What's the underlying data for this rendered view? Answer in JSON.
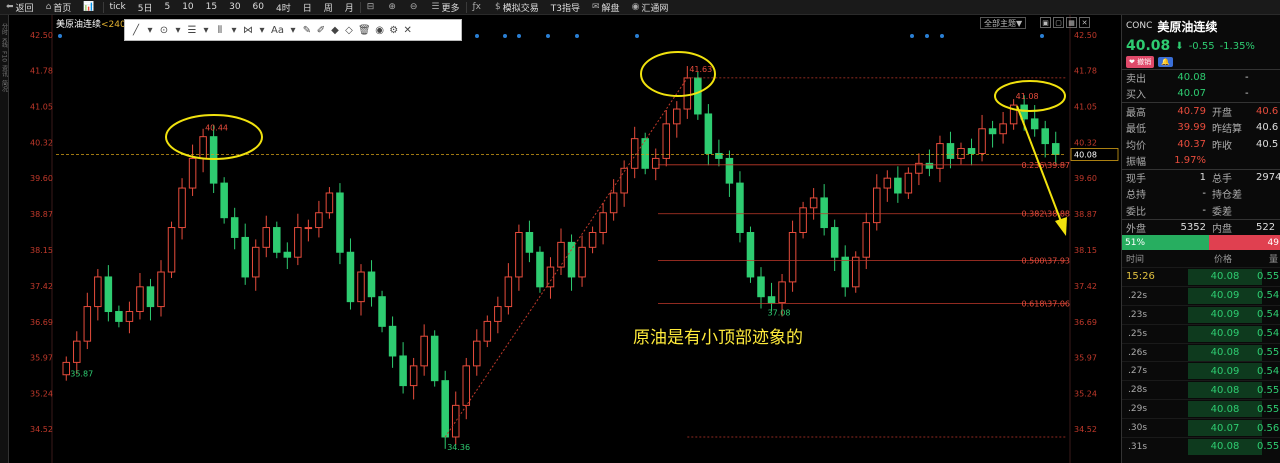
{
  "toolbar": {
    "items": [
      "返回",
      "首页",
      "",
      "tick",
      "5日",
      "5",
      "10",
      "15",
      "30",
      "60",
      "4时",
      "日",
      "周",
      "月",
      "",
      "",
      "",
      "更多",
      "",
      "模拟交易",
      "T3指导",
      "解盘",
      "汇通网"
    ]
  },
  "left_strip": [
    "分时",
    "K线",
    "F10",
    "资讯",
    "简况"
  ],
  "chart_title": {
    "name": "美原油连续",
    "period": "<240分"
  },
  "top_right_button": "全部主题▼",
  "drawbar": [
    "╱",
    "▾",
    "⊙",
    "▾",
    "☰",
    "▾",
    "⦀",
    "▾",
    "⋈",
    "▾",
    "Aa",
    "▾",
    "✎",
    "✐",
    "◆",
    "◇",
    "🗑",
    "◉",
    "⚙",
    "✕"
  ],
  "annotation": "原油是有小顶部迹象的",
  "axis_left_labels": [
    "42.50",
    "41.78",
    "41.05",
    "40.32",
    "39.60",
    "38.87",
    "38.15",
    "37.42",
    "36.69",
    "35.97",
    "35.24",
    "34.52"
  ],
  "axis_right_labels": [
    "42.50",
    "41.78",
    "41.05",
    "40.32",
    "39.60",
    "38.87",
    "38.15",
    "37.42",
    "36.69",
    "35.97",
    "35.24",
    "34.52"
  ],
  "price_markers": {
    "current": "40.08"
  },
  "peak_labels": [
    "40.44",
    "41.63",
    "41.08"
  ],
  "low_labels": [
    "35.87",
    "34.36",
    "37.08"
  ],
  "fib_labels": [
    "0.236\\39.87",
    "0.382\\38.88",
    "0.500\\37.93",
    "0.618\\37.06"
  ],
  "quote": {
    "code": "CONC",
    "name": "美原油连续",
    "price": "40.08",
    "arrow": "⬇",
    "change": "-0.55",
    "change_pct": "-1.35%",
    "tag1": "❤ 撤销",
    "tag2": "🔔",
    "sell_label": "卖出",
    "sell_price": "40.08",
    "sell_vol": "-",
    "buy_label": "买入",
    "buy_price": "40.07",
    "buy_vol": "-",
    "stats": [
      {
        "l1": "最高",
        "v1": "40.79",
        "c1": "up",
        "l2": "开盘",
        "v2": "40.6",
        "c2": "up"
      },
      {
        "l1": "最低",
        "v1": "39.99",
        "c1": "up",
        "l2": "昨结算",
        "v2": "40.6",
        "c2": "wh"
      },
      {
        "l1": "均价",
        "v1": "40.37",
        "c1": "up",
        "l2": "昨收",
        "v2": "40.5",
        "c2": "wh"
      },
      {
        "l1": "振幅",
        "v1": "1.97%",
        "c1": "up",
        "l2": "",
        "v2": "",
        "c2": "wh"
      },
      {
        "l1": "现手",
        "v1": "1",
        "c1": "wh",
        "l2": "总手",
        "v2": "2974",
        "c2": "wh"
      },
      {
        "l1": "总持",
        "v1": "-",
        "c1": "wh",
        "l2": "持仓差",
        "v2": "",
        "c2": "wh"
      },
      {
        "l1": "委比",
        "v1": "-",
        "c1": "wh",
        "l2": "委差",
        "v2": "",
        "c2": "wh"
      },
      {
        "l1": "外盘",
        "v1": "5352",
        "c1": "wh",
        "l2": "内盘",
        "v2": "522",
        "c2": "wh"
      }
    ],
    "ratio_left": "51%",
    "ratio_right": "49"
  },
  "ticks": {
    "headers": [
      "时间",
      "价格",
      "量"
    ],
    "rows": [
      {
        "t": "15:26",
        "p": "40.08",
        "v": "0.55"
      },
      {
        "t": ".22s",
        "p": "40.09",
        "v": "0.54"
      },
      {
        "t": ".23s",
        "p": "40.09",
        "v": "0.54"
      },
      {
        "t": ".25s",
        "p": "40.09",
        "v": "0.54"
      },
      {
        "t": ".26s",
        "p": "40.08",
        "v": "0.55"
      },
      {
        "t": ".27s",
        "p": "40.09",
        "v": "0.54"
      },
      {
        "t": ".28s",
        "p": "40.08",
        "v": "0.55"
      },
      {
        "t": ".29s",
        "p": "40.08",
        "v": "0.55"
      },
      {
        "t": ".30s",
        "p": "40.07",
        "v": "0.56"
      },
      {
        "t": ".31s",
        "p": "40.08",
        "v": "0.55"
      }
    ]
  },
  "chart_data": {
    "type": "candlestick",
    "symbol": "美原油连续",
    "period": "240分",
    "ylim": [
      34.4,
      42.6
    ],
    "up_color": "#e74c3c",
    "down_color": "#2ecc71",
    "closes": [
      35.87,
      36.3,
      37.0,
      37.6,
      36.9,
      36.7,
      36.9,
      37.4,
      37.0,
      37.7,
      38.6,
      39.4,
      40.0,
      40.44,
      39.5,
      38.8,
      38.4,
      37.6,
      38.2,
      38.6,
      38.1,
      38.0,
      38.6,
      38.6,
      38.9,
      39.3,
      38.1,
      37.1,
      37.7,
      37.2,
      36.6,
      36.0,
      35.4,
      35.8,
      36.4,
      35.5,
      34.36,
      35.0,
      35.8,
      36.3,
      36.7,
      37.0,
      37.6,
      38.5,
      38.1,
      37.4,
      37.8,
      38.3,
      37.6,
      38.2,
      38.5,
      38.9,
      39.3,
      39.8,
      40.4,
      39.8,
      40.0,
      40.7,
      41.0,
      41.63,
      40.9,
      40.1,
      40.0,
      39.5,
      38.5,
      37.6,
      37.2,
      37.08,
      37.5,
      38.5,
      39.0,
      39.2,
      38.6,
      38.0,
      37.4,
      38.0,
      38.7,
      39.4,
      39.6,
      39.3,
      39.7,
      39.9,
      39.8,
      40.3,
      40.0,
      40.2,
      40.1,
      40.6,
      40.5,
      40.7,
      41.08,
      40.8,
      40.6,
      40.3,
      40.08
    ]
  }
}
